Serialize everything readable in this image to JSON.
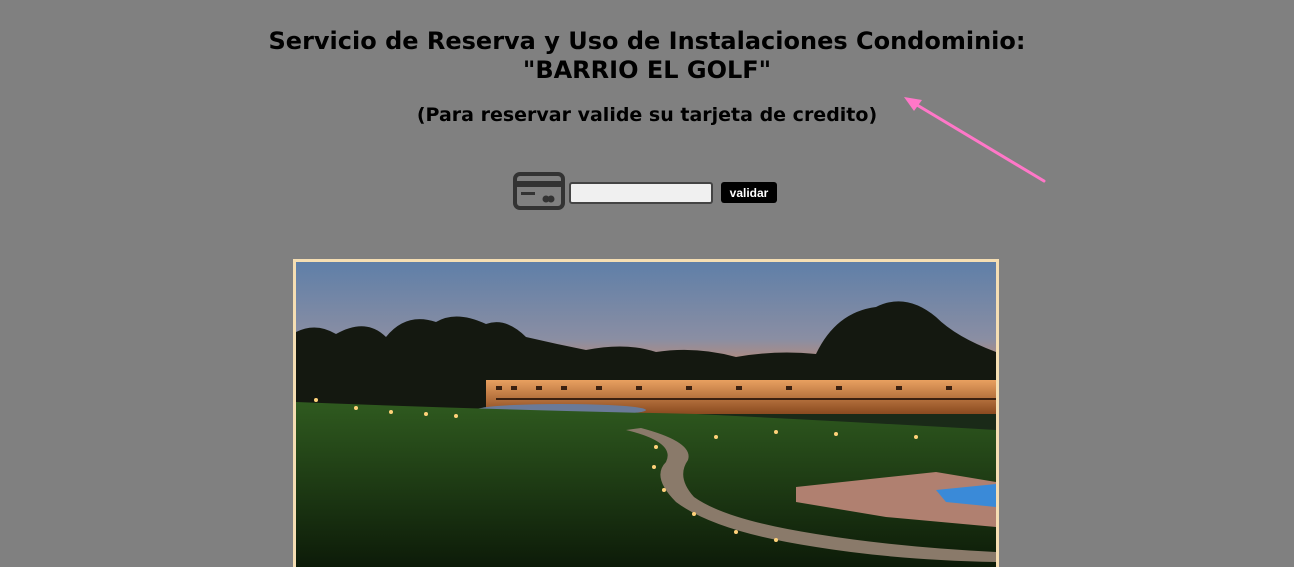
{
  "header": {
    "title_line1": "Servicio de Reserva y Uso de Instalaciones Condominio:",
    "title_line2": "\"BARRIO EL GOLF\"",
    "subtitle": "(Para reservar valide su tarjeta de credito)"
  },
  "card_form": {
    "icon": "credit-card-icon",
    "input_value": "",
    "input_placeholder": "",
    "button_label": "validar"
  },
  "photo": {
    "description_icon": "condominium-night-photo"
  },
  "colors": {
    "background": "#808080",
    "frame_border": "#f5deb3",
    "button_bg": "#000000",
    "annotation_arrow": "#ff77c8"
  }
}
